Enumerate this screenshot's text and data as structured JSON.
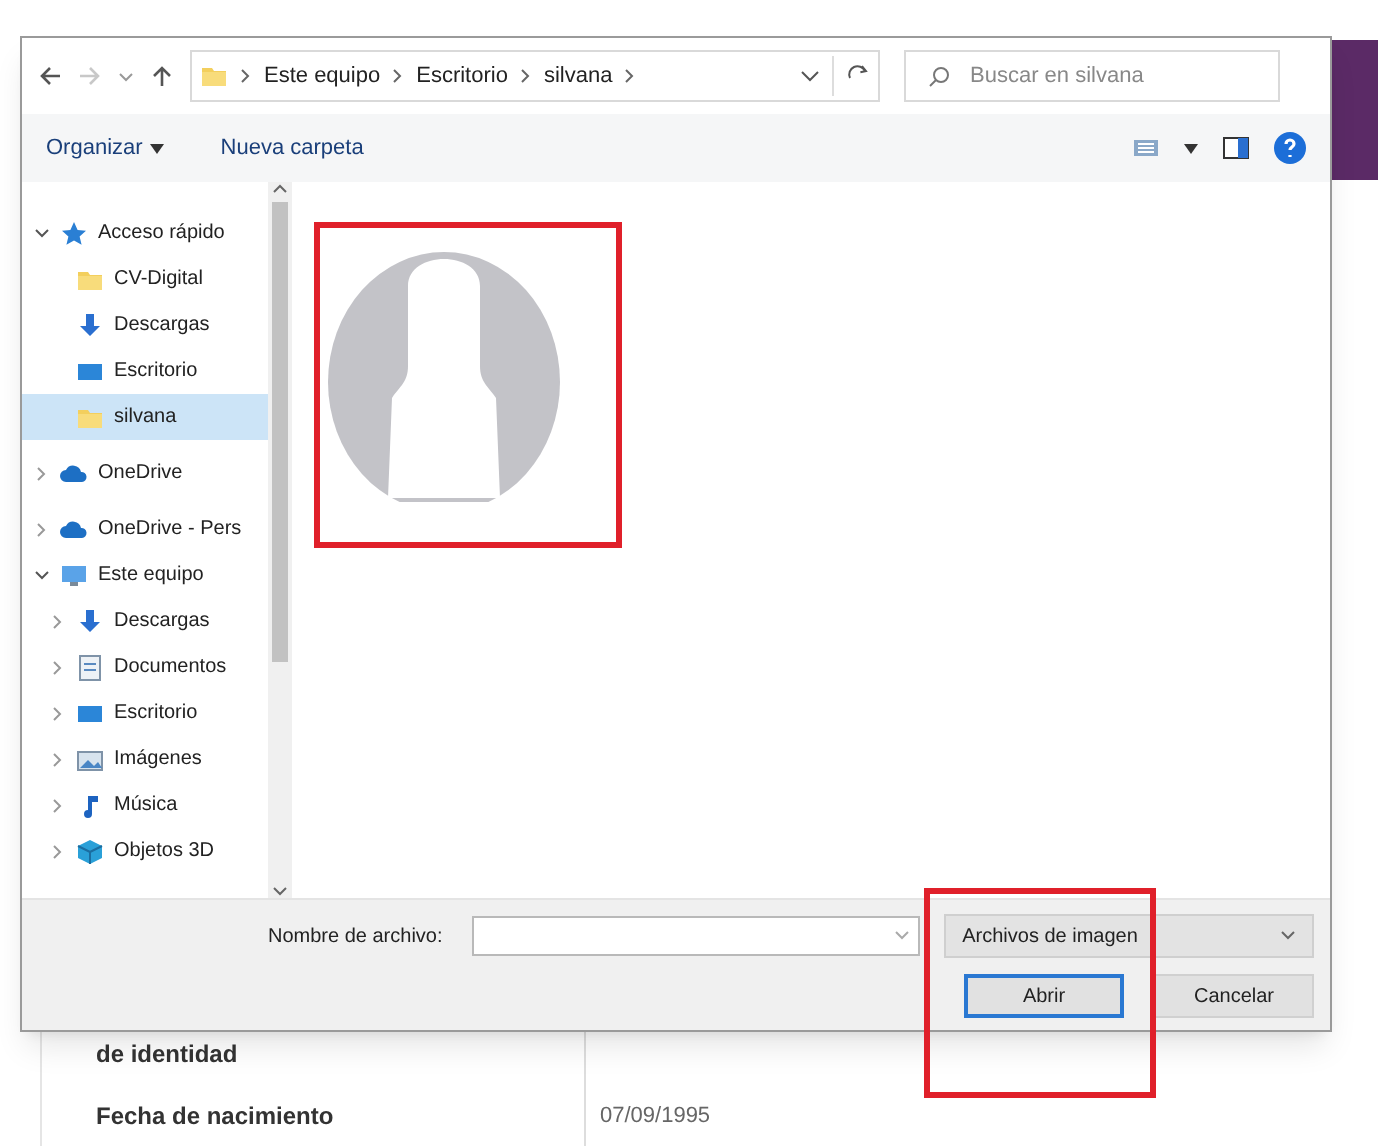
{
  "dialog": {
    "address": {
      "path": [
        "Este equipo",
        "Escritorio",
        "silvana"
      ]
    },
    "search": {
      "placeholder": "Buscar en silvana"
    },
    "toolbar": {
      "organize": "Organizar",
      "new_folder": "Nueva carpeta"
    },
    "sidebar": {
      "items": [
        {
          "label": "Acceso rápido",
          "kind": "star",
          "expanded": true,
          "selected": false,
          "children": [
            {
              "label": "CV-Digital",
              "kind": "folder",
              "selected": false
            },
            {
              "label": "Descargas",
              "kind": "download",
              "selected": false
            },
            {
              "label": "Escritorio",
              "kind": "desktop",
              "selected": false
            },
            {
              "label": "silvana",
              "kind": "folder",
              "selected": true
            }
          ]
        },
        {
          "label": "OneDrive",
          "kind": "cloud",
          "expanded": false,
          "selected": false
        },
        {
          "label": "OneDrive - Pers",
          "kind": "cloud",
          "expanded": false,
          "selected": false
        },
        {
          "label": "Este equipo",
          "kind": "pc",
          "expanded": true,
          "selected": false,
          "children": [
            {
              "label": "Descargas",
              "kind": "download",
              "expanded": false,
              "selected": false
            },
            {
              "label": "Documentos",
              "kind": "documents",
              "expanded": false,
              "selected": false
            },
            {
              "label": "Escritorio",
              "kind": "desktop",
              "expanded": false,
              "selected": false
            },
            {
              "label": "Imágenes",
              "kind": "pictures",
              "expanded": false,
              "selected": false
            },
            {
              "label": "Música",
              "kind": "music",
              "expanded": false,
              "selected": false
            },
            {
              "label": "Objetos 3D",
              "kind": "objects",
              "expanded": false,
              "selected": false
            }
          ]
        }
      ]
    },
    "footer": {
      "filename_label": "Nombre de archivo:",
      "file_type": "Archivos de imagen",
      "buttons": [
        {
          "label": "Abrir",
          "default": true
        },
        {
          "label": "Cancelar",
          "default": false
        }
      ]
    }
  },
  "background_form": {
    "rows": [
      {
        "label": "de identidad"
      },
      {
        "label": "Fecha de nacimiento",
        "value": "07/09/1995"
      }
    ]
  }
}
